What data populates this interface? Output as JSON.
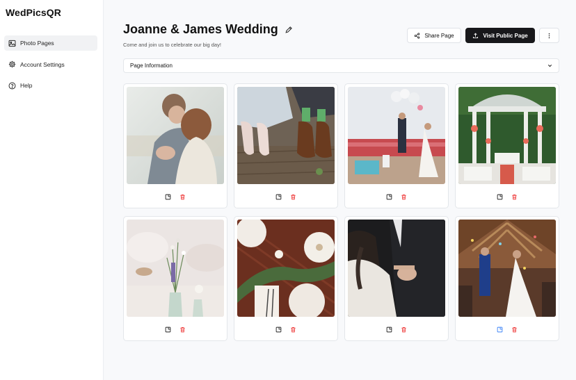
{
  "app": {
    "brand": "WedPicsQR"
  },
  "sidebar": {
    "items": [
      {
        "label": "Photo Pages",
        "icon": "image-icon",
        "active": true
      },
      {
        "label": "Account Settings",
        "icon": "gear-icon",
        "active": false
      },
      {
        "label": "Help",
        "icon": "help-circle-icon",
        "active": false
      }
    ]
  },
  "header": {
    "title": "Joanne & James Wedding",
    "subtitle": "Come and join us to celebrate our big day!",
    "share_label": "Share Page",
    "visit_label": "Visit Public Page"
  },
  "accordion": {
    "label": "Page Information"
  },
  "photos": [
    {
      "subject": "couple-embrace",
      "icon_color": "#222222"
    },
    {
      "subject": "shoes-on-wood",
      "icon_color": "#222222"
    },
    {
      "subject": "balloons-ceremony",
      "icon_color": "#222222"
    },
    {
      "subject": "garden-gazebo",
      "icon_color": "#222222"
    },
    {
      "subject": "table-flowers",
      "icon_color": "#222222"
    },
    {
      "subject": "dinner-table-top",
      "icon_color": "#222222"
    },
    {
      "subject": "couple-dance",
      "icon_color": "#222222"
    },
    {
      "subject": "confetti-exit",
      "icon_color": "#3b82f6"
    }
  ],
  "colors": {
    "accent_dark": "#18181b",
    "delete_red": "#ef4444",
    "selected_blue": "#3b82f6"
  }
}
